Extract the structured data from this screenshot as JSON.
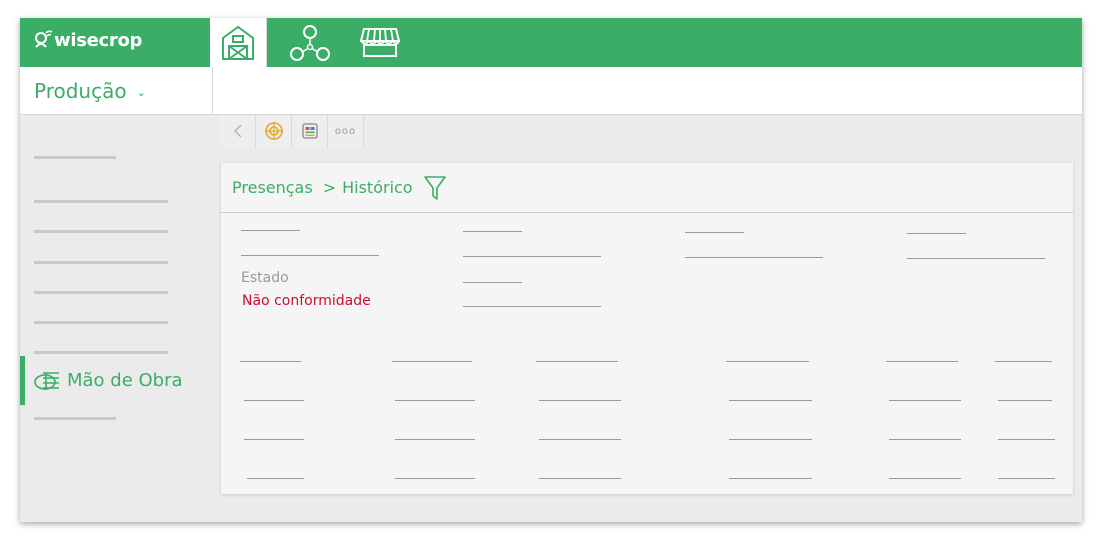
{
  "app": {
    "logo_text": "wisecrop"
  },
  "topnav": {
    "items": [
      {
        "icon": "barn-icon",
        "active": true
      },
      {
        "icon": "network-icon",
        "active": false
      },
      {
        "icon": "market-stall-icon",
        "active": false
      }
    ]
  },
  "module_selector": {
    "label": "Produção",
    "chevron": "⌄"
  },
  "toolbar": {
    "more_label": "ooo"
  },
  "sidebar": {
    "active_item": "Mão de Obra"
  },
  "breadcrumb": {
    "parent": "Presenças",
    "separator": ">",
    "current": "Histórico"
  },
  "status": {
    "label": "Estado",
    "value": "Não conformidade",
    "value_color": "#c8102e"
  },
  "colors": {
    "accent": "#3aae66",
    "background": "#ebebeb"
  }
}
